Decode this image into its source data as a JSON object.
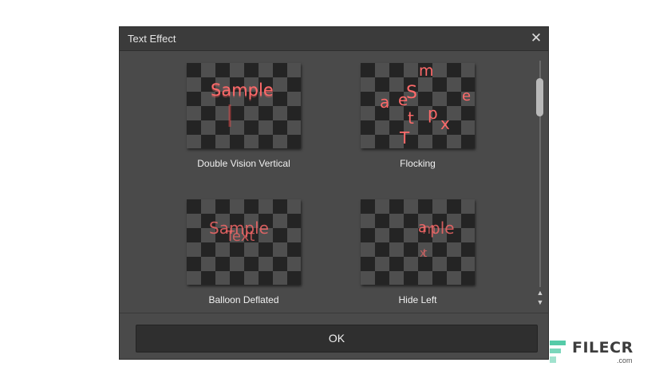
{
  "dialog": {
    "title": "Text Effect",
    "close_icon": "close-icon",
    "ok_label": "OK"
  },
  "effects": [
    {
      "label": "Double Vision Vertical",
      "preview_text": "Sample"
    },
    {
      "label": "Flocking",
      "preview_letters": [
        "m",
        "a",
        "e",
        "S",
        "e",
        "p",
        "t",
        "x",
        "T"
      ]
    },
    {
      "label": "Balloon Deflated",
      "preview_text": "Sample",
      "preview_text_2": "Text"
    },
    {
      "label": "Hide Left",
      "preview_text": "ple",
      "preview_letters": [
        "a",
        "m",
        "x",
        "t"
      ]
    }
  ],
  "scrollbar": {
    "up_icon": "arrow-up-icon",
    "down_icon": "arrow-down-icon"
  },
  "colors": {
    "accent_glow": "#ff6a6a",
    "dialog_bg": "#4a4a4a",
    "titlebar_bg": "#3b3b3b"
  },
  "watermark": {
    "brand": "FILECR",
    "domain": ".com",
    "brand_color": "#3d3d3d",
    "logo_color": "#43c59e"
  }
}
